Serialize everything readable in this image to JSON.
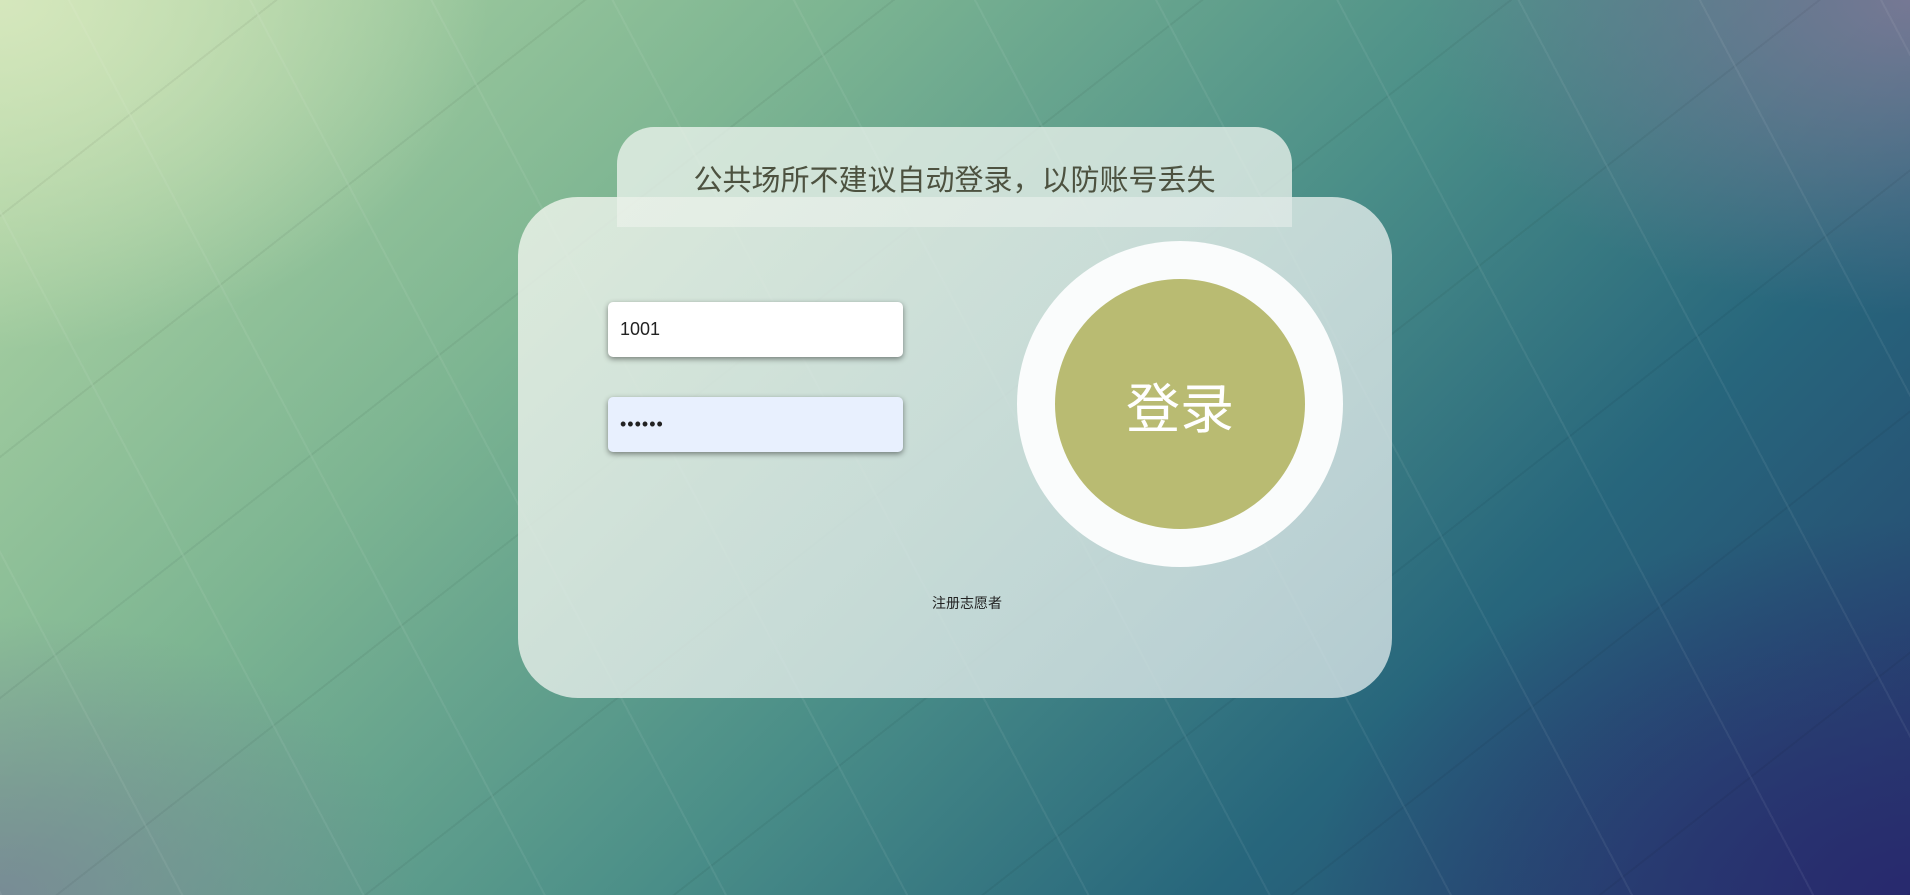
{
  "notice": "公共场所不建议自动登录，以防账号丢失",
  "form": {
    "username_value": "1001",
    "password_value": "123456"
  },
  "login_button": "登录",
  "register_link": "注册志愿者",
  "colors": {
    "login_button": "#b9bb72",
    "ring": "#fafcfc"
  }
}
